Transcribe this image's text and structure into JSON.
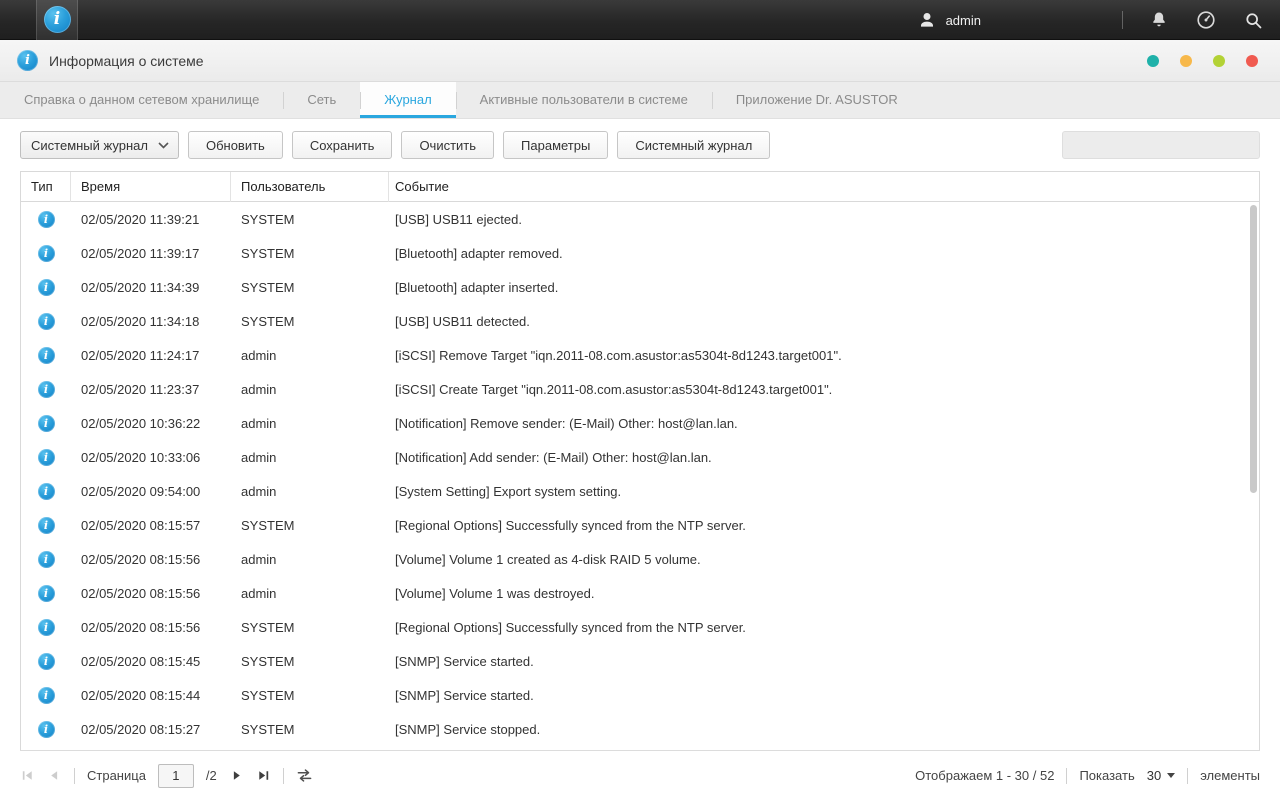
{
  "colors": {
    "accent": "#2aa7df",
    "info_icon": "#1d94d2"
  },
  "topbar": {
    "user": "admin",
    "icons": [
      "user-icon",
      "bell-icon",
      "gauge-icon",
      "search-icon"
    ]
  },
  "window": {
    "title": "Информация о системе",
    "controls": [
      {
        "name": "teal",
        "color": "#1fb1a9"
      },
      {
        "name": "yellow",
        "color": "#f7b84a"
      },
      {
        "name": "green",
        "color": "#b3d235"
      },
      {
        "name": "red",
        "color": "#f05a50"
      }
    ]
  },
  "tabs": [
    {
      "label": "Справка о данном сетевом хранилище",
      "active": false
    },
    {
      "label": "Сеть",
      "active": false
    },
    {
      "label": "Журнал",
      "active": true
    },
    {
      "label": "Активные пользователи в системе",
      "active": false
    },
    {
      "label": "Приложение Dr. ASUSTOR",
      "active": false
    }
  ],
  "toolbar": {
    "log_type_dropdown": "Системный журнал",
    "buttons": [
      "Обновить",
      "Сохранить",
      "Очистить",
      "Параметры",
      "Системный журнал"
    ],
    "search_value": ""
  },
  "table": {
    "columns": [
      "Тип",
      "Время",
      "Пользователь",
      "Событие"
    ],
    "rows": [
      {
        "time": "02/05/2020 11:39:21",
        "user": "SYSTEM",
        "event": "[USB] USB11 ejected."
      },
      {
        "time": "02/05/2020 11:39:17",
        "user": "SYSTEM",
        "event": "[Bluetooth] adapter removed."
      },
      {
        "time": "02/05/2020 11:34:39",
        "user": "SYSTEM",
        "event": "[Bluetooth] adapter inserted."
      },
      {
        "time": "02/05/2020 11:34:18",
        "user": "SYSTEM",
        "event": "[USB] USB11 detected."
      },
      {
        "time": "02/05/2020 11:24:17",
        "user": "admin",
        "event": "[iSCSI] Remove Target \"iqn.2011-08.com.asustor:as5304t-8d1243.target001\"."
      },
      {
        "time": "02/05/2020 11:23:37",
        "user": "admin",
        "event": "[iSCSI] Create Target \"iqn.2011-08.com.asustor:as5304t-8d1243.target001\"."
      },
      {
        "time": "02/05/2020 10:36:22",
        "user": "admin",
        "event": "[Notification] Remove sender: (E-Mail) Other: host@lan.lan."
      },
      {
        "time": "02/05/2020 10:33:06",
        "user": "admin",
        "event": "[Notification] Add sender: (E-Mail) Other: host@lan.lan."
      },
      {
        "time": "02/05/2020 09:54:00",
        "user": "admin",
        "event": "[System Setting] Export system setting."
      },
      {
        "time": "02/05/2020 08:15:57",
        "user": "SYSTEM",
        "event": "[Regional Options] Successfully synced from the NTP server."
      },
      {
        "time": "02/05/2020 08:15:56",
        "user": "admin",
        "event": "[Volume] Volume 1 created as 4-disk RAID 5 volume."
      },
      {
        "time": "02/05/2020 08:15:56",
        "user": "admin",
        "event": "[Volume] Volume 1 was destroyed."
      },
      {
        "time": "02/05/2020 08:15:56",
        "user": "SYSTEM",
        "event": "[Regional Options] Successfully synced from the NTP server."
      },
      {
        "time": "02/05/2020 08:15:45",
        "user": "SYSTEM",
        "event": "[SNMP] Service started."
      },
      {
        "time": "02/05/2020 08:15:44",
        "user": "SYSTEM",
        "event": "[SNMP] Service started."
      },
      {
        "time": "02/05/2020 08:15:27",
        "user": "SYSTEM",
        "event": "[SNMP] Service stopped."
      }
    ]
  },
  "pagination": {
    "page_label": "Страница",
    "current_page": "1",
    "total_pages": "/2",
    "showing": "Отображаем 1 - 30 / 52",
    "show_label": "Показать",
    "page_size": "30",
    "items_label": "элементы"
  }
}
